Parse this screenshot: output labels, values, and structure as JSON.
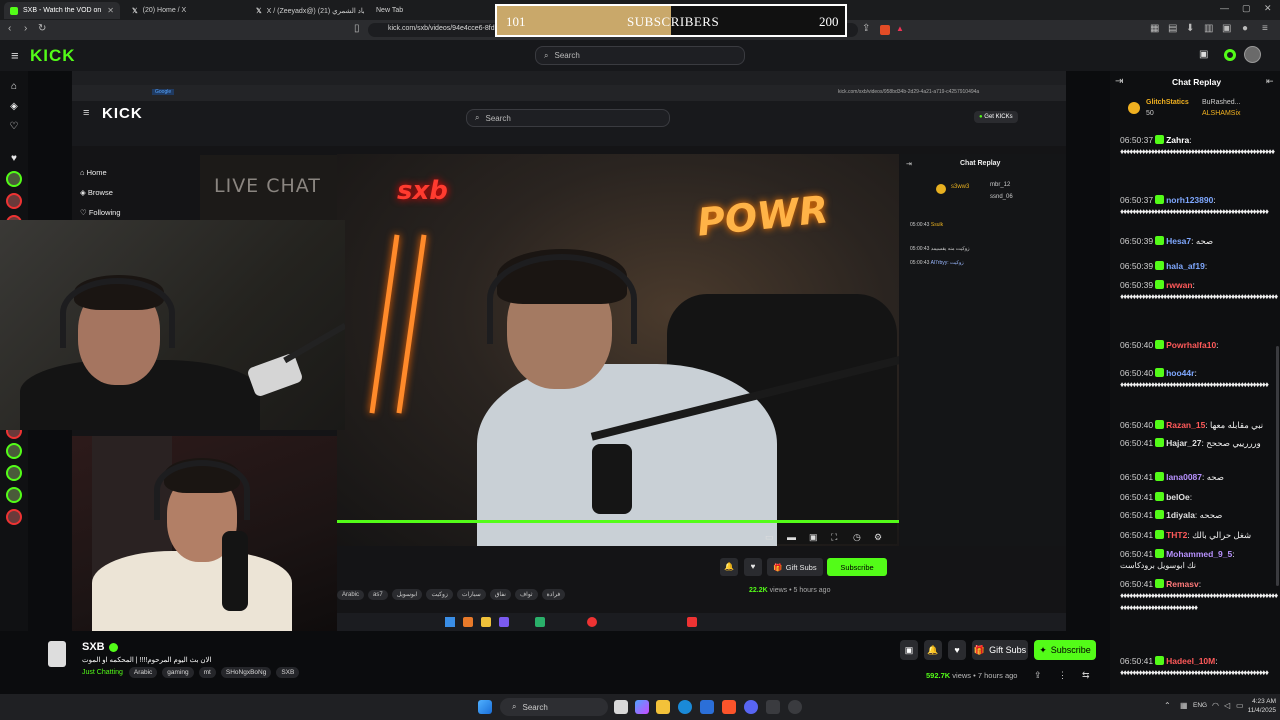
{
  "browser": {
    "tabs": [
      {
        "label": "SXB - Watch the VOD on Kick",
        "color": "#53fc18",
        "active": true
      },
      {
        "label": "(20) Home / X",
        "color": "#ffffff"
      },
      {
        "label": "X / (Zeeyadx@) زياد الشمري (21)",
        "color": "#ffffff"
      },
      {
        "label": "New Tab",
        "color": "#888888"
      }
    ],
    "url": "kick.com/sxb/videos/94e4cce6-8fd"
  },
  "subscribers_bar": {
    "start": "101",
    "label": "SUBSCRIBERS",
    "goal": "200",
    "progress": 0.5
  },
  "kick": {
    "logo": "KICK",
    "search_placeholder": "Search"
  },
  "inner": {
    "logo": "KICK",
    "search_placeholder": "Search",
    "get_kicks": "Get KICKs",
    "url": "kick.com/sxb/videos/958bd34b-2d29-4a21-a719-c4257910494a",
    "nav": [
      {
        "label": "Home",
        "icon": "home-icon"
      },
      {
        "label": "Browse",
        "icon": "compass-icon"
      },
      {
        "label": "Following",
        "icon": "heart-icon"
      }
    ],
    "stream_overlay_text": "LIVE CHAT",
    "chat_title": "Chat Replay",
    "chat_top": [
      "s3ww3",
      "mbr_12",
      "ssnd_06"
    ],
    "chat_lines": [
      {
        "time": "05:00:43",
        "text": "Ssulk"
      },
      {
        "time": "05:00:43",
        "text": "زوكيت منه يقسيمد"
      },
      {
        "time": "05:00:43",
        "text": "Al7rbyy: زوكيت"
      }
    ],
    "gift_subs": "Gift Subs",
    "subscribe": "Subscribe",
    "views": "22.2K",
    "views_label": "views",
    "ago": "5 hours ago",
    "tags": [
      "Arabic",
      "as7",
      "ابوسويل",
      "زوكيت",
      "سيارات",
      "نفاق",
      "ثواف",
      "فرادة"
    ]
  },
  "stream_info": {
    "channel": "SXB",
    "title": "الان بث اليوم المرحوم!!!! | المحكمه او الموت",
    "category": "Just Chatting",
    "tags": [
      "Arabic",
      "gaming",
      "mt",
      "SHoNgxBoNg",
      "SXB"
    ],
    "views": "592.7K",
    "views_label": "views",
    "ago": "7 hours ago",
    "gift_subs": "Gift Subs",
    "subscribe": "Subscribe"
  },
  "chat": {
    "title": "Chat Replay",
    "top_gifters": [
      {
        "name": "GlitchStatics",
        "count": "50"
      },
      {
        "name": "BuRashed...",
        "count": ""
      },
      {
        "name": "ALSHAMSix",
        "count": ""
      }
    ],
    "messages": [
      {
        "time": "06:50:37",
        "user": "Zahra",
        "color": "#ffffff",
        "text": ":",
        "dots": "♦♦♦♦♦♦♦♦♦♦♦♦♦♦♦♦♦♦♦♦♦♦♦♦♦♦♦♦♦♦♦♦♦♦♦♦♦♦♦♦♦♦♦♦♦♦♦♦♦♦"
      },
      {
        "time": "06:50:37",
        "user": "norh123890",
        "color": "#7fa8ff",
        "text": ":",
        "dots": "♦♦♦♦♦♦♦♦♦♦♦♦♦♦♦♦♦♦♦♦♦♦♦♦♦♦♦♦♦♦♦♦♦♦♦♦♦♦♦♦♦♦♦♦♦♦♦♦"
      },
      {
        "time": "06:50:39",
        "user": "Hesa7",
        "color": "#7fa8ff",
        "text": ": صحه",
        "dots": ""
      },
      {
        "time": "06:50:39",
        "user": "hala_af19",
        "color": "#7fa8ff",
        "text": ":",
        "dots": ""
      },
      {
        "time": "06:50:39",
        "user": "rwwan",
        "color": "#ff5a5a",
        "text": ":",
        "dots": "♦♦♦♦♦♦♦♦♦♦♦♦♦♦♦♦♦♦♦♦♦♦♦♦♦♦♦♦♦♦♦♦♦♦♦♦♦♦♦♦♦♦♦♦♦♦♦♦♦♦♦"
      },
      {
        "time": "06:50:40",
        "user": "Powrhalfa10",
        "color": "#ff5a5a",
        "text": ":",
        "dots": ""
      },
      {
        "time": "06:50:40",
        "user": "hoo44r",
        "color": "#7fa8ff",
        "text": ":",
        "dots": "♦♦♦♦♦♦♦♦♦♦♦♦♦♦♦♦♦♦♦♦♦♦♦♦♦♦♦♦♦♦♦♦♦♦♦♦♦♦♦♦♦♦♦♦♦♦♦♦"
      },
      {
        "time": "06:50:40",
        "user": "Razan_15",
        "color": "#ff5a5a",
        "text": ": نبي مقابله معها",
        "dots": ""
      },
      {
        "time": "06:50:41",
        "user": "Hajar_27",
        "color": "#e0e0e0",
        "text": ": ورررييي صححح",
        "dots": ""
      },
      {
        "time": "06:50:41",
        "user": "lana0087",
        "color": "#b892ff",
        "text": ": صحه",
        "dots": ""
      },
      {
        "time": "06:50:41",
        "user": "belOe",
        "color": "#e0e0e0",
        "text": ":",
        "dots": ""
      },
      {
        "time": "06:50:41",
        "user": "1diyala",
        "color": "#e0e0e0",
        "text": ": صححه",
        "dots": ""
      },
      {
        "time": "06:50:41",
        "user": "THT2",
        "color": "#ff5a5a",
        "text": ": شغل حرالي بالك",
        "dots": ""
      },
      {
        "time": "06:50:41",
        "user": "Mohammed_9_5",
        "color": "#b892ff",
        "text": ":",
        "dots": "نك ابوسويل برودكاست"
      },
      {
        "time": "06:50:41",
        "user": "Remasv",
        "color": "#ff7a7a",
        "text": ":",
        "dots": "♦♦♦♦♦♦♦♦♦♦♦♦♦♦♦♦♦♦♦♦♦♦♦♦♦♦♦♦♦♦♦♦♦♦♦♦♦♦♦♦♦♦♦♦♦♦♦♦♦♦♦♦♦♦♦♦♦♦♦♦♦♦♦♦♦♦♦♦♦♦♦♦♦♦♦♦"
      },
      {
        "time": "06:50:41",
        "user": "Hadeel_10M",
        "color": "#ff5a5a",
        "text": ":",
        "dots": "♦♦♦♦♦♦♦♦♦♦♦♦♦♦♦♦♦♦♦♦♦♦♦♦♦♦♦♦♦♦♦♦♦♦♦♦♦♦♦♦♦♦♦♦♦♦♦♦"
      }
    ]
  },
  "taskbar": {
    "search": "Search",
    "lang": "ENG",
    "time": "4:23 AM",
    "date": "11/4/2025"
  },
  "colors": {
    "brand": "#53fc18",
    "chat_bg": "#0e0f11"
  }
}
